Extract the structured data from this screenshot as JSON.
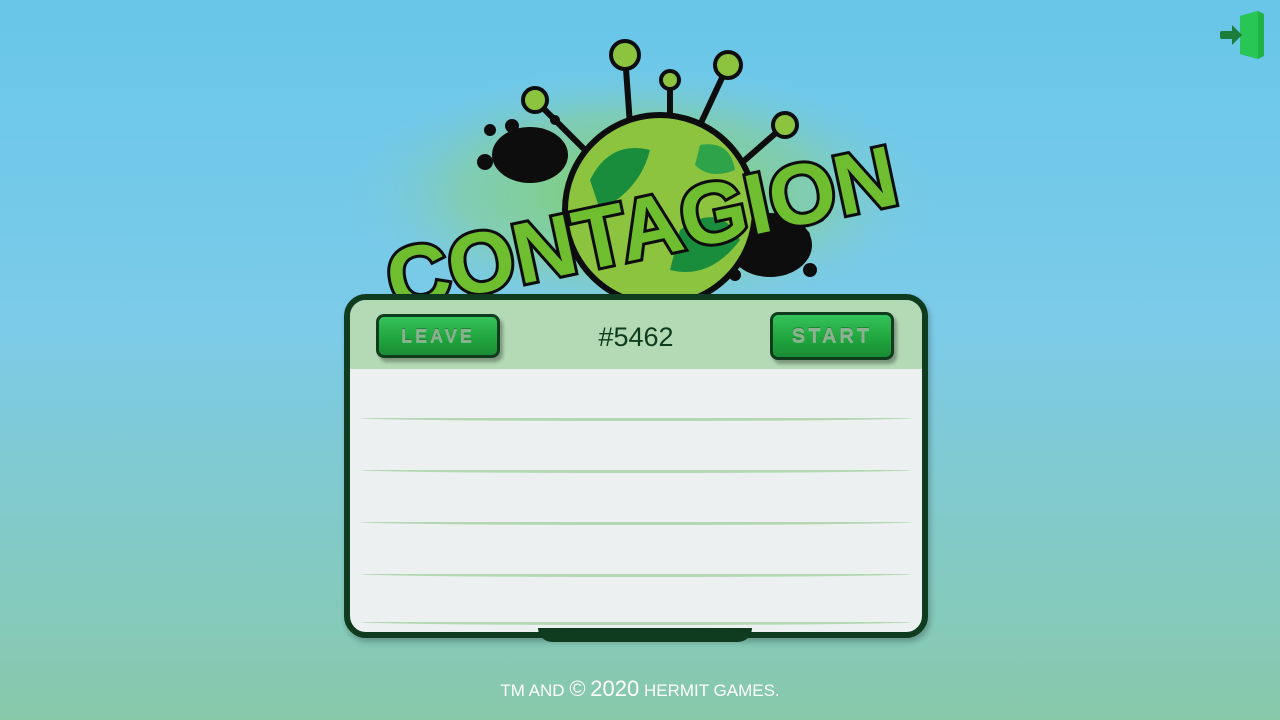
{
  "logo": {
    "text": "CONTAGION"
  },
  "room": {
    "id": "#5462",
    "leave_label": "LEAVE",
    "start_label": "START"
  },
  "players": [
    "",
    "",
    "",
    "",
    ""
  ],
  "footer": {
    "prefix": "TM AND",
    "symbol": "©",
    "year": "2020",
    "company": "HERMIT GAMES."
  },
  "colors": {
    "accent_green": "#21a63f",
    "dark_green": "#0f3b1e",
    "header_green": "#b3d9b5",
    "panel_bg": "#ecf0f0"
  },
  "icons": {
    "exit": "exit-door-icon"
  }
}
